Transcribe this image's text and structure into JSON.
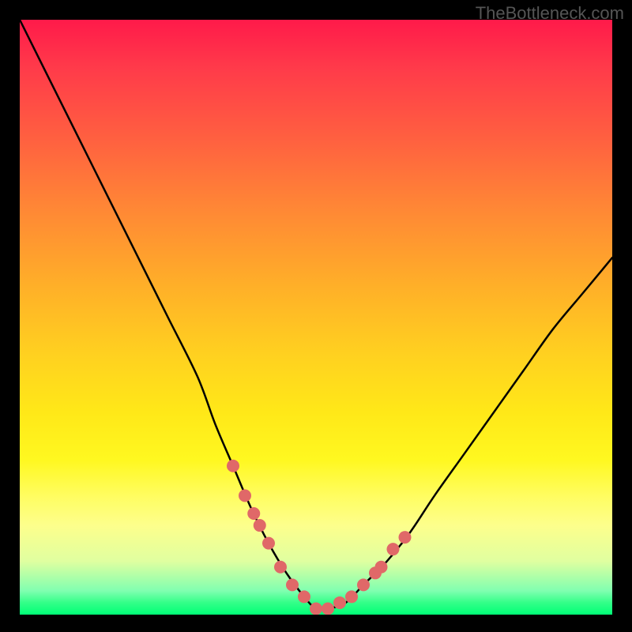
{
  "watermark": "TheBottleneck.com",
  "chart_data": {
    "type": "line",
    "title": "",
    "xlabel": "",
    "ylabel": "",
    "xlim": [
      0,
      100
    ],
    "ylim": [
      0,
      100
    ],
    "series": [
      {
        "name": "bottleneck-curve",
        "x": [
          0,
          5,
          10,
          15,
          20,
          25,
          30,
          33,
          36,
          39,
          42,
          45,
          48,
          50,
          52,
          55,
          58,
          62,
          66,
          70,
          75,
          80,
          85,
          90,
          95,
          100
        ],
        "values": [
          100,
          90,
          80,
          70,
          60,
          50,
          40,
          32,
          25,
          18,
          12,
          7,
          3,
          1,
          1,
          2,
          5,
          9,
          14,
          20,
          27,
          34,
          41,
          48,
          54,
          60
        ]
      }
    ],
    "markers": {
      "name": "highlight-points",
      "color": "#e06868",
      "x": [
        36,
        38,
        39.5,
        40.5,
        42,
        44,
        46,
        48,
        50,
        52,
        54,
        56,
        58,
        60,
        61,
        63,
        65
      ],
      "values": [
        25,
        20,
        17,
        15,
        12,
        8,
        5,
        3,
        1,
        1,
        2,
        3,
        5,
        7,
        8,
        11,
        13
      ]
    }
  }
}
